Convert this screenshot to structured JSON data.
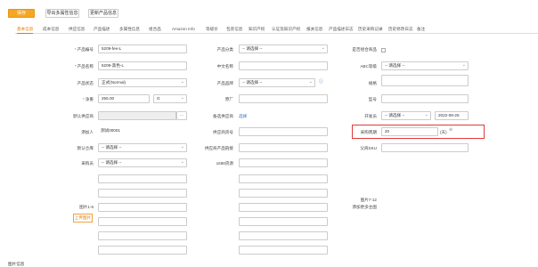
{
  "toolbar": {
    "save_label": "保存",
    "import_multi_attr_label": "导出多属性信息",
    "update_product_info_label": "更新产品信息"
  },
  "tabs": [
    "基本信息",
    "成本信息",
    "供应信息",
    "产品描述",
    "多属性信息",
    "组合品",
    "Amazon Info",
    "等级价",
    "包装信息",
    "知识产权",
    "认证及知识产权",
    "报关信息",
    "产品描述日志",
    "历史采购记录",
    "历史修改日志",
    "备注"
  ],
  "form": {
    "sku_label": "产品编号",
    "sku_value": "5209-fee-L",
    "category_label": "产品分类",
    "category_placeholder": "-- 请选择 --",
    "is_combo_label": "是否组合商品",
    "name_label": "产品名称",
    "name_value": "5209-黑色-L",
    "cn_name_label": "中文名称",
    "abc_label": "ABC等级",
    "abc_placeholder": "-- 请选择 --",
    "status_label": "产品状态",
    "status_value": "正式(Normal)",
    "brand_label": "产品品牌",
    "brand_placeholder": "-- 请选择 --",
    "spec_label": "规格",
    "weight_label": "净重",
    "weight_value": "255.00",
    "weight_unit": "G",
    "factory_sku_label": "原厂",
    "model_label": "型号",
    "default_supplier_label": "默认供应商",
    "alternate_supplier_label": "备选供应商",
    "alternate_supplier_link": "选择",
    "developer_label": "开发员",
    "developer_placeholder": "-- 请选择 --",
    "develop_date": "2022-09-26",
    "creator_label": "添加人",
    "creator_value": "测试00001",
    "supplier_code_label": "供应商货号",
    "lead_time_label": "采购周期",
    "lead_time_value": "20",
    "lead_time_unit": "(天)",
    "default_warehouse_label": "默认仓库",
    "default_warehouse_placeholder": "-- 请选择 --",
    "supplier_product_link_label": "供应商产品链接",
    "parent_sku_label": "父商SKU",
    "buyer_label": "采购员",
    "buyer_placeholder": "-- 请选择 --",
    "hs_code_label": "1688货源",
    "images_1_6_label": "图片1-6",
    "upload_label": "上传图片",
    "images_7_12_label": "图片7-12",
    "add_more_label": "添加更多主图",
    "product_info_label": "图片信息"
  },
  "colors": {
    "primary": "#f5a623",
    "active_tab": "#e07d00",
    "highlight": "#e23a3a",
    "link": "#2a6ebb"
  }
}
